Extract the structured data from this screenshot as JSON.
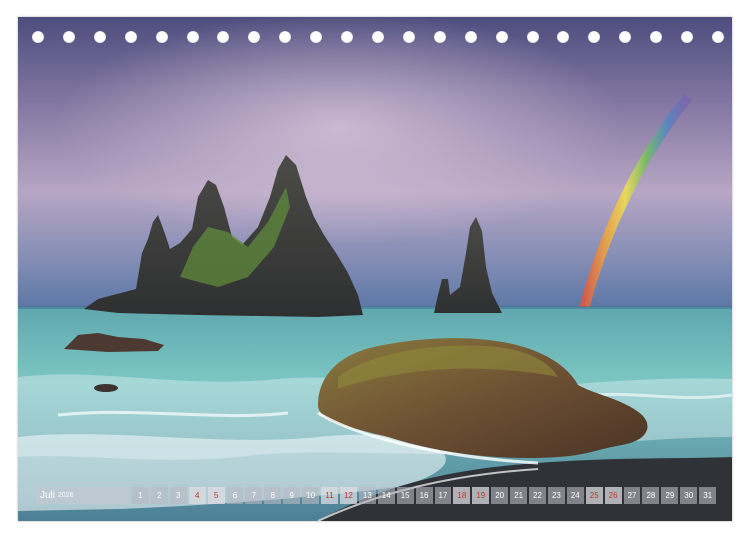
{
  "calendar": {
    "month": "Juli",
    "year": "2026",
    "days": [
      {
        "num": "1",
        "sunday": false,
        "mark": ""
      },
      {
        "num": "2",
        "sunday": false,
        "mark": ""
      },
      {
        "num": "3",
        "sunday": false,
        "mark": ""
      },
      {
        "num": "4",
        "sunday": true,
        "mark": ""
      },
      {
        "num": "5",
        "sunday": true,
        "mark": ""
      },
      {
        "num": "6",
        "sunday": false,
        "mark": ""
      },
      {
        "num": "7",
        "sunday": false,
        "mark": ""
      },
      {
        "num": "8",
        "sunday": false,
        "mark": ""
      },
      {
        "num": "9",
        "sunday": false,
        "mark": ""
      },
      {
        "num": "10",
        "sunday": false,
        "mark": ""
      },
      {
        "num": "11",
        "sunday": true,
        "mark": ""
      },
      {
        "num": "12",
        "sunday": true,
        "mark": ""
      },
      {
        "num": "13",
        "sunday": false,
        "mark": ""
      },
      {
        "num": "14",
        "sunday": false,
        "mark": ""
      },
      {
        "num": "15",
        "sunday": false,
        "mark": ""
      },
      {
        "num": "16",
        "sunday": false,
        "mark": ""
      },
      {
        "num": "17",
        "sunday": false,
        "mark": ""
      },
      {
        "num": "18",
        "sunday": true,
        "mark": ""
      },
      {
        "num": "19",
        "sunday": true,
        "mark": ""
      },
      {
        "num": "20",
        "sunday": false,
        "mark": ""
      },
      {
        "num": "21",
        "sunday": false,
        "mark": ""
      },
      {
        "num": "22",
        "sunday": false,
        "mark": ""
      },
      {
        "num": "23",
        "sunday": false,
        "mark": ""
      },
      {
        "num": "24",
        "sunday": false,
        "mark": ""
      },
      {
        "num": "25",
        "sunday": true,
        "mark": ""
      },
      {
        "num": "26",
        "sunday": true,
        "mark": ""
      },
      {
        "num": "27",
        "sunday": false,
        "mark": ""
      },
      {
        "num": "28",
        "sunday": false,
        "mark": ""
      },
      {
        "num": "29",
        "sunday": false,
        "mark": ""
      },
      {
        "num": "30",
        "sunday": false,
        "mark": ""
      },
      {
        "num": "31",
        "sunday": false,
        "mark": ""
      }
    ]
  },
  "binding_holes": 23,
  "colors": {
    "sky_top": "#4a4a78",
    "sky_mid": "#b9a7c6",
    "sea": "#6fb9b4",
    "sunday_text": "#c0392b"
  }
}
